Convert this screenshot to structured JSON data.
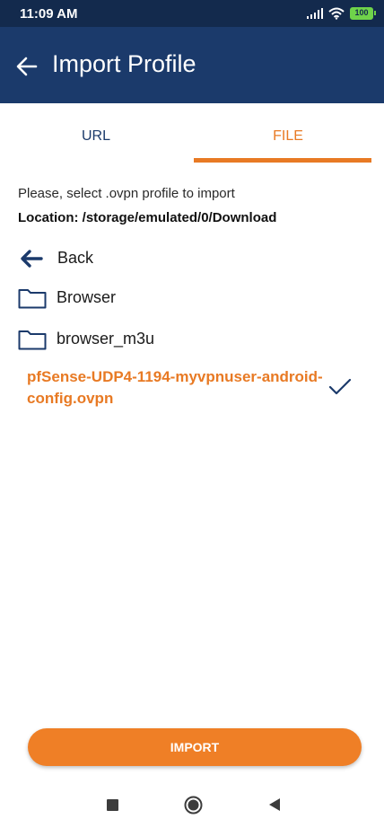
{
  "status_bar": {
    "time": "11:09 AM",
    "battery": "100"
  },
  "app_bar": {
    "title": "Import Profile"
  },
  "tabs": [
    {
      "label": "URL"
    },
    {
      "label": "FILE"
    }
  ],
  "content": {
    "instruction": "Please, select .ovpn profile to import",
    "location": "Location: /storage/emulated/0/Download",
    "back_label": "Back",
    "folders": [
      {
        "label": "Browser"
      },
      {
        "label": "browser_m3u"
      }
    ],
    "selected_file": "pfSense-UDP4-1194-myvpnuser-android-config.ovpn"
  },
  "import_button": {
    "label": "IMPORT"
  },
  "colors": {
    "app_bar": "#1b3a6b",
    "status_bar": "#132a4d",
    "accent": "#e87a24"
  },
  "icons": [
    "back-arrow-icon",
    "arrow-left-icon",
    "folder-icon",
    "check-icon",
    "signal-icon",
    "wifi-icon",
    "battery-icon",
    "recents-icon",
    "home-icon",
    "back-triangle-icon"
  ]
}
